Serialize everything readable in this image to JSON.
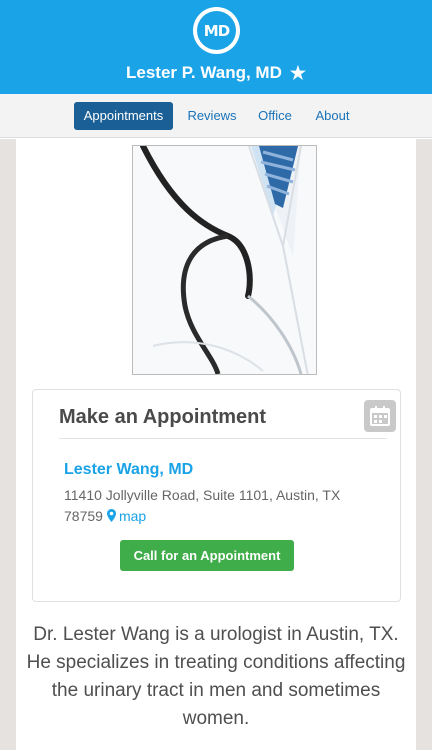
{
  "header": {
    "logo_text": "MD",
    "doctor_name": "Lester P. Wang, MD",
    "favorite_icon": "star-icon",
    "background_color": "#1aa3e6"
  },
  "nav": {
    "tabs": [
      {
        "label": "Appointments",
        "active": true
      },
      {
        "label": "Reviews",
        "active": false
      },
      {
        "label": "Office",
        "active": false
      },
      {
        "label": "About",
        "active": false
      }
    ]
  },
  "profile": {
    "photo_alt": "Doctor in white coat with stethoscope"
  },
  "appointment": {
    "title": "Make an Appointment",
    "calendar_icon": "calendar-icon",
    "doctor": "Lester Wang, MD",
    "address": "11410 Jollyville Road, Suite 1101, Austin, TX 78759",
    "map_icon": "map-marker-icon",
    "map_label": "map",
    "call_button": "Call for an Appointment",
    "call_button_color": "#3fad4a"
  },
  "bio": {
    "text": "Dr. Lester Wang is a urologist in Austin, TX. He specializes in treating conditions affecting the urinary tract in men and sometimes women."
  }
}
